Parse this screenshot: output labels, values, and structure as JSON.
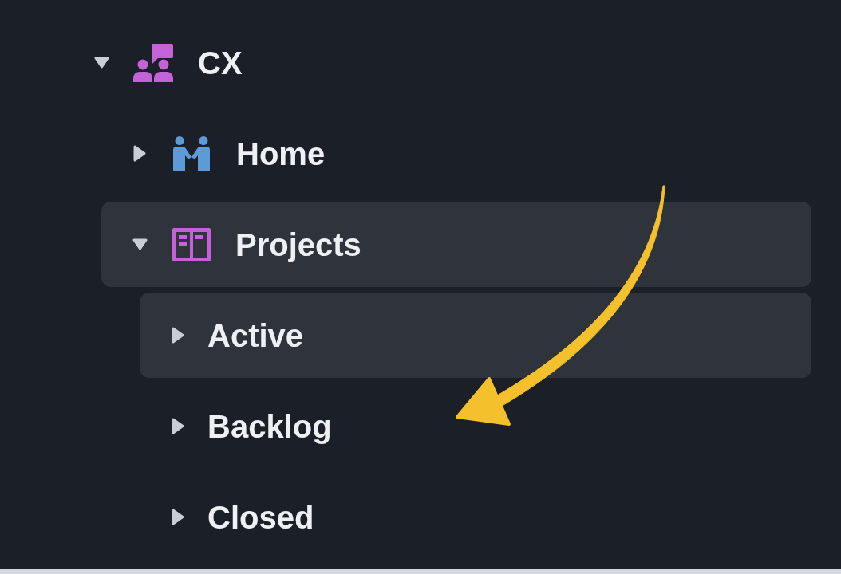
{
  "tree": [
    {
      "label": "CX",
      "kind": "space",
      "expanded": true,
      "selected": false,
      "children": [
        {
          "label": "Home",
          "kind": "page",
          "expanded": false,
          "selected": false
        },
        {
          "label": "Projects",
          "kind": "board",
          "expanded": true,
          "selected": true,
          "children": [
            {
              "label": "Active",
              "expanded": false,
              "selected": true
            },
            {
              "label": "Backlog",
              "expanded": false,
              "selected": false
            },
            {
              "label": "Closed",
              "expanded": false,
              "selected": false
            }
          ]
        }
      ]
    }
  ]
}
